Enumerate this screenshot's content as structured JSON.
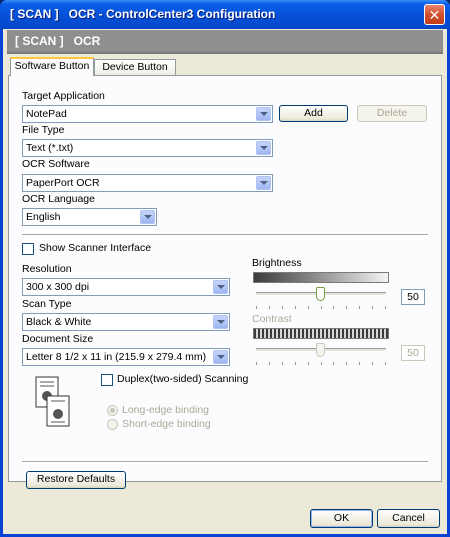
{
  "window": {
    "title": "[ SCAN ]   OCR - ControlCenter3 Configuration",
    "close_glyph": "✕"
  },
  "header": {
    "title": "[ SCAN ]   OCR"
  },
  "tabs": [
    {
      "label": "Software Button",
      "active": true
    },
    {
      "label": "Device Button",
      "active": false
    }
  ],
  "target_application": {
    "label": "Target Application",
    "value": "NotePad",
    "add_label": "Add",
    "delete_label": "Delete"
  },
  "file_type": {
    "label": "File Type",
    "value": "Text (*.txt)"
  },
  "ocr_software": {
    "label": "OCR Software",
    "value": "PaperPort OCR"
  },
  "ocr_language": {
    "label": "OCR Language",
    "value": "English"
  },
  "show_scanner_interface": {
    "label": "Show Scanner Interface",
    "checked": false
  },
  "resolution": {
    "label": "Resolution",
    "value": "300 x 300 dpi"
  },
  "scan_type": {
    "label": "Scan Type",
    "value": "Black & White"
  },
  "document_size": {
    "label": "Document Size",
    "value": "Letter 8 1/2 x 11 in (215.9 x 279.4 mm)"
  },
  "brightness": {
    "label": "Brightness",
    "value": "50",
    "level": 0.5
  },
  "contrast": {
    "label": "Contrast",
    "value": "50",
    "level": 0.5,
    "enabled": false
  },
  "duplex": {
    "label": "Duplex(two-sided) Scanning",
    "checked": false,
    "long_edge_label": "Long-edge binding",
    "short_edge_label": "Short-edge binding"
  },
  "restore_defaults_label": "Restore Defaults",
  "footer": {
    "ok_label": "OK",
    "cancel_label": "Cancel"
  },
  "colors": {
    "titlebar": "#0650d8",
    "tab_highlight": "#ffc83c",
    "client_bg": "#ece9d8"
  }
}
